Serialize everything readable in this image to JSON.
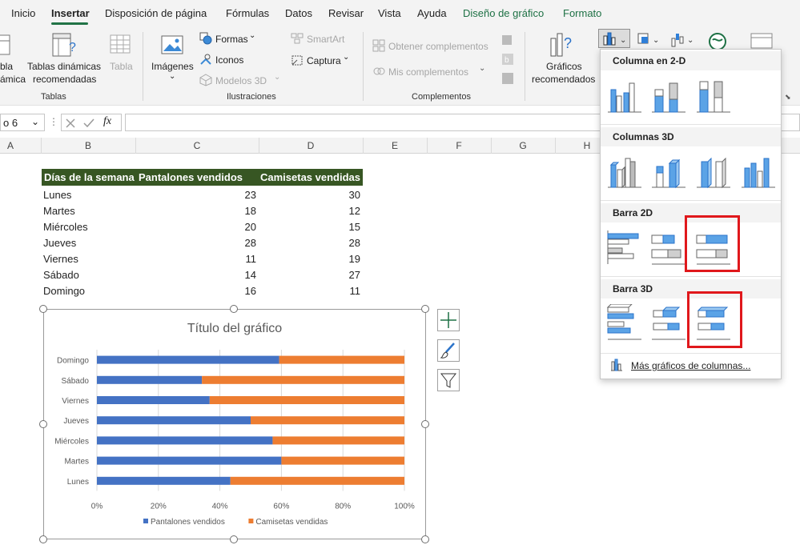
{
  "menu": {
    "tabs": [
      "Inicio",
      "Insertar",
      "Disposición de página",
      "Fórmulas",
      "Datos",
      "Revisar",
      "Vista",
      "Ayuda",
      "Diseño de gráfico",
      "Formato"
    ]
  },
  "ribbon": {
    "groups": {
      "tablas": "Tablas",
      "ilustraciones": "Ilustraciones",
      "complementos": "Complementos"
    },
    "tabla_din_frag_1": "bla",
    "tabla_din_frag_2": "ámica",
    "tablas_dinamicas_1": "Tablas dinámicas",
    "tablas_dinamicas_2": "recomendadas",
    "tabla": "Tabla",
    "imagenes": "Imágenes",
    "formas": "Formas",
    "iconos": "Iconos",
    "modelos3d": "Modelos 3D",
    "smartart": "SmartArt",
    "captura": "Captura",
    "obtener_complementos": "Obtener complementos",
    "mis_complementos": "Mis complementos",
    "graficos_1": "Gráficos",
    "graficos_2": "recomendados"
  },
  "formula_bar": {
    "namebox": "o 6",
    "fx": "fx"
  },
  "columns": [
    "A",
    "B",
    "C",
    "D",
    "E",
    "F",
    "G",
    "H"
  ],
  "table": {
    "headers": [
      "Días de la semana",
      "Pantalones vendidos",
      "Camisetas vendidas"
    ],
    "rows": [
      {
        "day": "Lunes",
        "pantalones": "23",
        "camisetas": "30"
      },
      {
        "day": "Martes",
        "pantalones": "18",
        "camisetas": "12"
      },
      {
        "day": "Miércoles",
        "pantalones": "20",
        "camisetas": "15"
      },
      {
        "day": "Jueves",
        "pantalones": "28",
        "camisetas": "28"
      },
      {
        "day": "Viernes",
        "pantalones": "11",
        "camisetas": "19"
      },
      {
        "day": "Sábado",
        "pantalones": "14",
        "camisetas": "27"
      },
      {
        "day": "Domingo",
        "pantalones": "16",
        "camisetas": "11"
      }
    ]
  },
  "chart_data": {
    "type": "bar",
    "stacked": "100%",
    "title": "Título del gráfico",
    "categories": [
      "Domingo",
      "Sábado",
      "Viernes",
      "Jueves",
      "Miércoles",
      "Martes",
      "Lunes"
    ],
    "series": [
      {
        "name": "Pantalones vendidos",
        "color": "#4472c4",
        "values": [
          16,
          14,
          11,
          28,
          20,
          18,
          23
        ]
      },
      {
        "name": "Camisetas vendidas",
        "color": "#ed7d31",
        "values": [
          11,
          27,
          19,
          28,
          15,
          12,
          30
        ]
      }
    ],
    "x_tick_labels": [
      "0%",
      "20%",
      "40%",
      "60%",
      "80%",
      "100%"
    ],
    "xlim": [
      0,
      1
    ],
    "grid": true,
    "legend": "bottom"
  },
  "dropdown": {
    "sections": [
      "Columna en 2-D",
      "Columnas 3D",
      "Barra 2D",
      "Barra 3D"
    ],
    "more_link": "Más gráficos de columnas..."
  },
  "colors": {
    "accent": "#217346",
    "table_header": "#375623",
    "highlight": "#e0181c",
    "icon_blue": "#5ba3e6"
  }
}
